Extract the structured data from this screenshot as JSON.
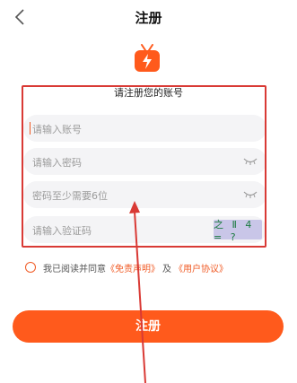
{
  "header": {
    "title": "注册",
    "back_icon": "chevron-left-icon"
  },
  "app": {
    "logo_icon": "tv-lightning-icon",
    "brand_color": "#ff5a1c",
    "subtitle": "请注册您的账号"
  },
  "form": {
    "account_placeholder": "请输入账号",
    "password_placeholder": "请输入密码",
    "confirm_placeholder": "密码至少需要6位",
    "code_placeholder": "请输入验证码",
    "captcha_text": "之 Ⅱ 4 = ?"
  },
  "agreement": {
    "prefix": "我已阅读并同意",
    "disclaimer": "《免责声明》",
    "and": "及",
    "user_agreement": "《用户协议》"
  },
  "buttons": {
    "register_label": "注册"
  },
  "annotation": {
    "color": "#d93a35"
  }
}
